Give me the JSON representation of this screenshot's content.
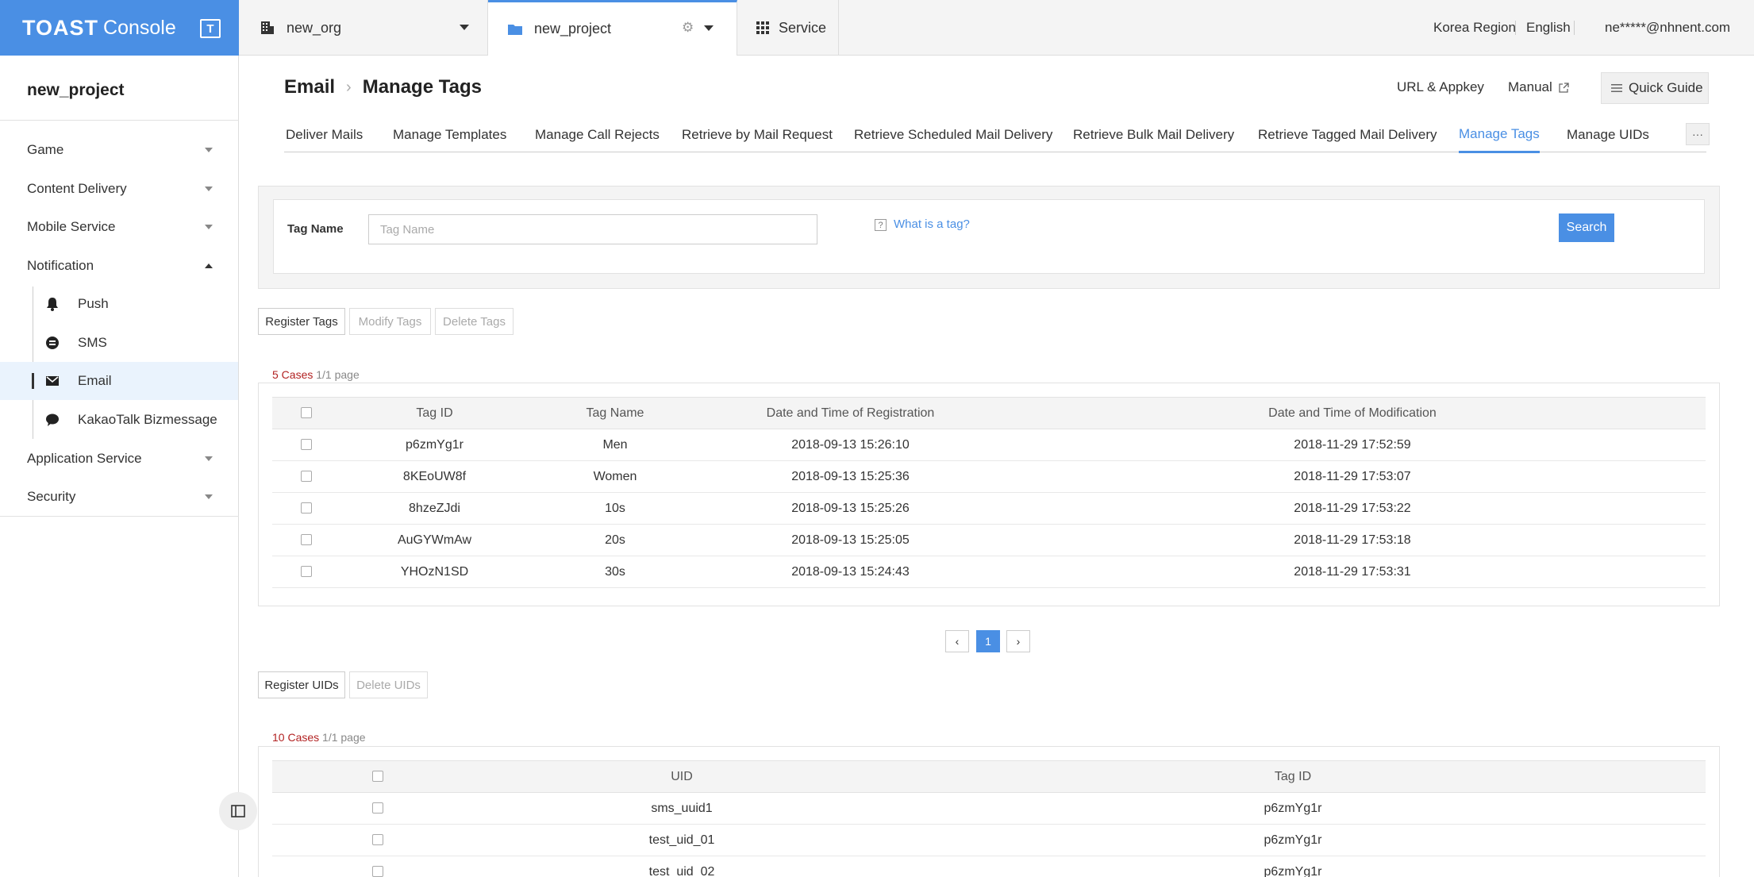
{
  "topbar": {
    "logo_brand": "TOAST",
    "logo_product": "Console",
    "logo_badge": "T",
    "org": "new_org",
    "project": "new_project",
    "service": "Service",
    "region": "Korea Region",
    "language": "English",
    "user": "ne*****@nhnent.com"
  },
  "sidebar": {
    "project_name": "new_project",
    "items": [
      {
        "label": "Game"
      },
      {
        "label": "Content Delivery"
      },
      {
        "label": "Mobile Service"
      },
      {
        "label": "Notification"
      },
      {
        "label": "Application Service"
      },
      {
        "label": "Security"
      }
    ],
    "notification_sub": [
      {
        "label": "Push"
      },
      {
        "label": "SMS"
      },
      {
        "label": "Email"
      },
      {
        "label": "KakaoTalk Bizmessage"
      }
    ]
  },
  "header": {
    "breadcrumb_service": "Email",
    "breadcrumb_page": "Manage Tags",
    "url_appkey": "URL & Appkey",
    "manual": "Manual",
    "quick_guide": "Quick Guide"
  },
  "tabs": [
    {
      "label": "Deliver Mails"
    },
    {
      "label": "Manage Templates"
    },
    {
      "label": "Manage Call Rejects"
    },
    {
      "label": "Retrieve by Mail Request"
    },
    {
      "label": "Retrieve Scheduled Mail Delivery"
    },
    {
      "label": "Retrieve Bulk Mail Delivery"
    },
    {
      "label": "Retrieve Tagged Mail Delivery"
    },
    {
      "label": "Manage Tags"
    },
    {
      "label": "Manage UIDs"
    }
  ],
  "tabs_more": "···",
  "search": {
    "label": "Tag Name",
    "placeholder": "Tag Name",
    "help_icon": "?",
    "help_text": "What is a tag?",
    "button": "Search"
  },
  "tag_actions": {
    "register": "Register Tags",
    "modify": "Modify Tags",
    "delete": "Delete Tags"
  },
  "tags_table": {
    "count": "5 Cases",
    "pages": "1/1 page",
    "headers": [
      "Tag ID",
      "Tag Name",
      "Date and Time of Registration",
      "Date and Time of Modification"
    ],
    "rows": [
      [
        "p6zmYg1r",
        "Men",
        "2018-09-13 15:26:10",
        "2018-11-29 17:52:59"
      ],
      [
        "8KEoUW8f",
        "Women",
        "2018-09-13 15:25:36",
        "2018-11-29 17:53:07"
      ],
      [
        "8hzeZJdi",
        "10s",
        "2018-09-13 15:25:26",
        "2018-11-29 17:53:22"
      ],
      [
        "AuGYWmAw",
        "20s",
        "2018-09-13 15:25:05",
        "2018-11-29 17:53:18"
      ],
      [
        "YHOzN1SD",
        "30s",
        "2018-09-13 15:24:43",
        "2018-11-29 17:53:31"
      ]
    ]
  },
  "pager": {
    "prev": "‹",
    "current": "1",
    "next": "›"
  },
  "uid_actions": {
    "register": "Register UIDs",
    "delete": "Delete UIDs"
  },
  "uids_table": {
    "count": "10 Cases",
    "pages": "1/1 page",
    "headers": [
      "UID",
      "Tag ID"
    ],
    "rows": [
      [
        "sms_uuid1",
        "p6zmYg1r"
      ],
      [
        "test_uid_01",
        "p6zmYg1r"
      ],
      [
        "test_uid_02",
        "p6zmYg1r"
      ]
    ]
  },
  "colors": {
    "accent": "#4a8fe4",
    "count_red": "#b22222"
  }
}
